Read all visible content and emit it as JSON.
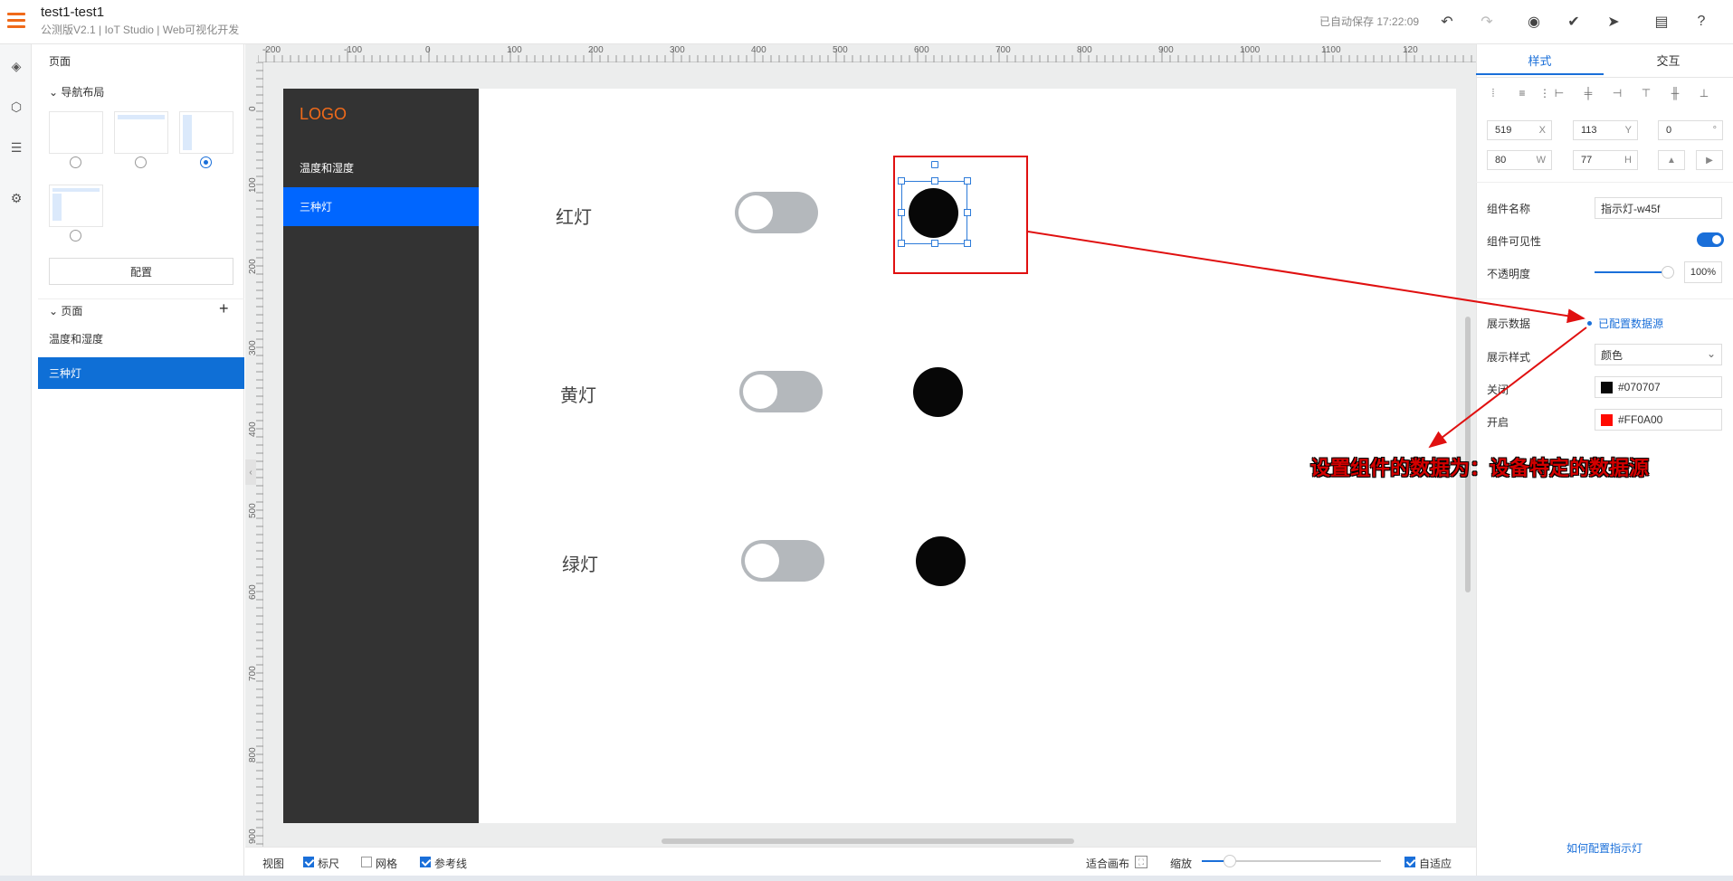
{
  "header": {
    "title": "test1-test1",
    "subtitle": "公测版V2.1 | IoT Studio | Web可视化开发",
    "autosave": "已自动保存 17:22:09",
    "icons": [
      "undo-icon",
      "redo-icon",
      "preview-icon",
      "check-icon",
      "publish-icon",
      "doc-icon",
      "help-icon"
    ]
  },
  "left_panel": {
    "title": "页面",
    "nav_layout_label": "导航布局",
    "config_button": "配置",
    "pages_label": "页面",
    "pages": [
      "温度和湿度",
      "三种灯"
    ],
    "selected_layout": 3
  },
  "ruler": {
    "h_ticks": [
      "-200",
      "-100",
      "0",
      "100",
      "200",
      "300",
      "400",
      "500",
      "600",
      "700",
      "800",
      "900",
      "1000",
      "1100",
      "120"
    ],
    "v_ticks": [
      "0",
      "100",
      "200",
      "300",
      "400",
      "500",
      "600",
      "700",
      "800",
      "900"
    ]
  },
  "canvas": {
    "logo": "LOGO",
    "nav_items": [
      "温度和湿度",
      "三种灯"
    ],
    "active_nav": "三种灯",
    "lights": [
      {
        "label": "红灯",
        "switch_on": false,
        "color": "#070707"
      },
      {
        "label": "黄灯",
        "switch_on": false,
        "color": "#070707"
      },
      {
        "label": "绿灯",
        "switch_on": false,
        "color": "#070707"
      }
    ]
  },
  "bottom_bar": {
    "view_label": "视图",
    "ruler_label": "标尺",
    "ruler_checked": true,
    "grid_label": "网格",
    "grid_checked": false,
    "guide_label": "参考线",
    "guide_checked": true,
    "fit_label": "适合画布",
    "zoom_label": "缩放",
    "auto_fit_label": "自适应",
    "auto_fit_checked": true
  },
  "right_panel": {
    "tabs": [
      "样式",
      "交互"
    ],
    "active_tab": "样式",
    "geometry": {
      "x": "519",
      "x_unit": "X",
      "y": "113",
      "y_unit": "Y",
      "rotation": "0",
      "rotation_unit": "°",
      "w": "80",
      "w_unit": "W",
      "h": "77",
      "h_unit": "H"
    },
    "component_name_label": "组件名称",
    "component_name": "指示灯-w45f",
    "visible_label": "组件可见性",
    "visible": true,
    "opacity_label": "不透明度",
    "opacity": "100%",
    "display_data_label": "展示数据",
    "datasource_link": "已配置数据源",
    "display_style_label": "展示样式",
    "display_style": "颜色",
    "off_label": "关闭",
    "off_color": "#070707",
    "on_label": "开启",
    "on_color": "#FF0A00",
    "help_link": "如何配置指示灯"
  },
  "annotation": {
    "text": "设置组件的数据为：设备特定的数据源",
    "color": "#d40000"
  }
}
